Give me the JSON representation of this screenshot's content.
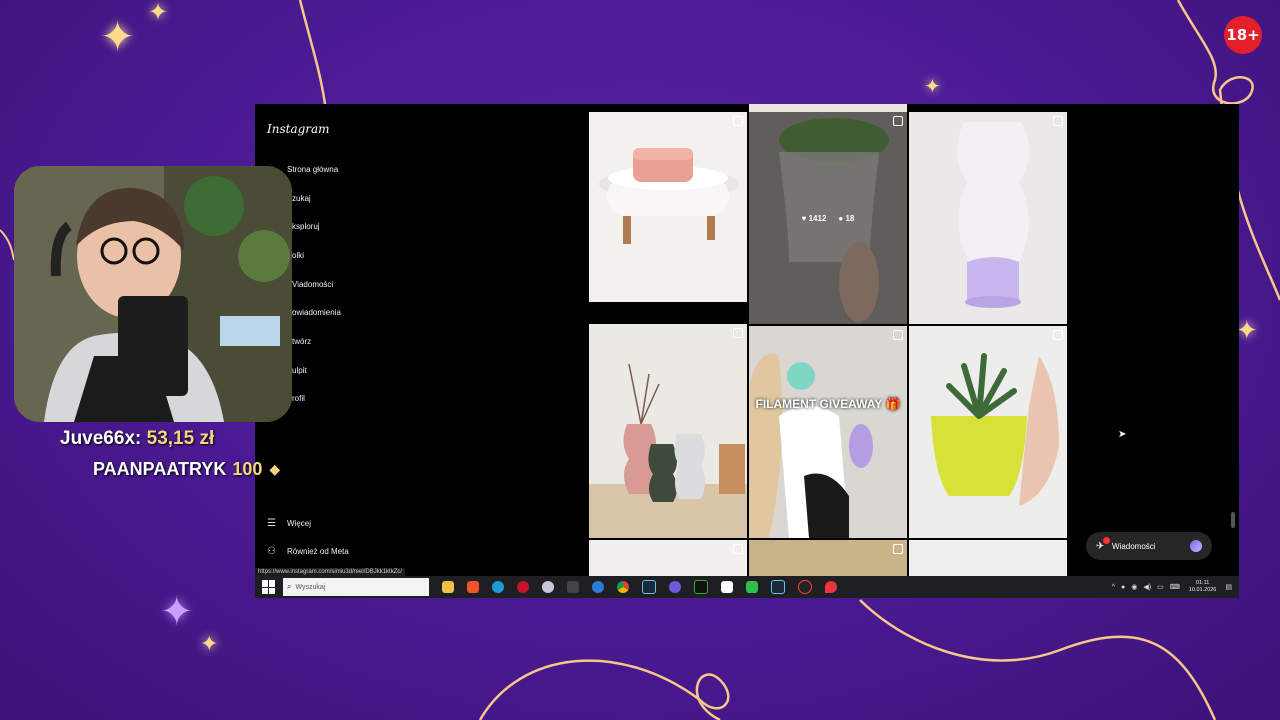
{
  "stream": {
    "age_badge": "18+",
    "donation_name": "Juve66x:",
    "donation_amount": "53,15 zł",
    "sub_name": "PAANPAATRYK",
    "sub_count": "100"
  },
  "instagram": {
    "logo": "Instagram",
    "nav": [
      {
        "label": "Strona główna",
        "icon": "home-icon"
      },
      {
        "label": "zukaj",
        "icon": "search-icon"
      },
      {
        "label": "ksploruj",
        "icon": "explore-icon"
      },
      {
        "label": "olki",
        "icon": "reels-icon"
      },
      {
        "label": "Viadomości",
        "icon": "messages-icon"
      },
      {
        "label": "owiadomienia",
        "icon": "heart-icon"
      },
      {
        "label": "twórz",
        "icon": "create-icon"
      },
      {
        "label": "ulpit",
        "icon": "dashboard-icon"
      },
      {
        "label": "rofil",
        "icon": "profile-icon"
      }
    ],
    "more_label": "Więcej",
    "meta_label": "Również od Meta",
    "status_url": "https://www.instagram.com/simiu3d/reel/DBJkk1ktkZc/",
    "hover_likes": "1412",
    "hover_comments": "18",
    "giveaway_text": "FILAMENT GIVEAWAY 🎁",
    "messages_pill": "Wiadomości"
  },
  "taskbar": {
    "search_placeholder": "Wyszukaj",
    "time": "01:11",
    "date": "10.01.2026"
  },
  "colors": {
    "background": "#4a1a92",
    "accent_gold": "#f5d67a",
    "badge_red": "#e3202a"
  }
}
